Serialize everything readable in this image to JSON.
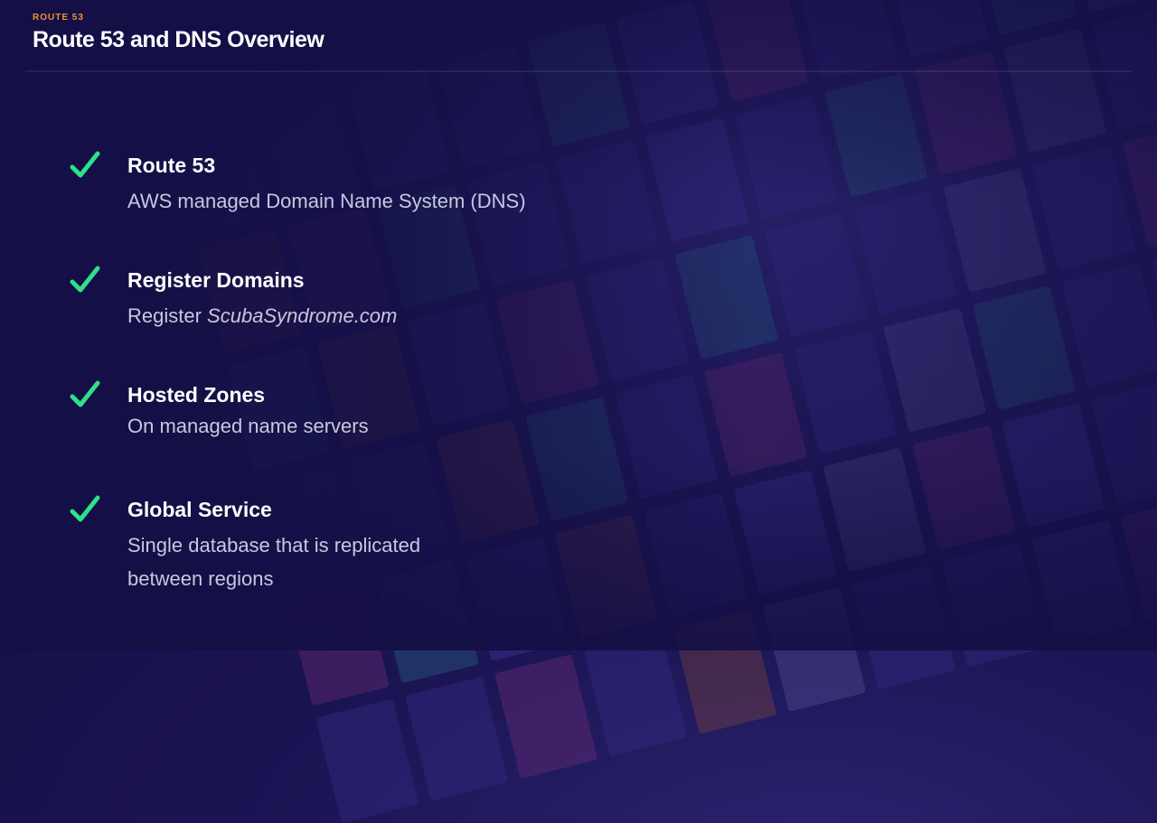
{
  "header": {
    "eyebrow": "ROUTE 53",
    "title": "Route 53 and DNS Overview"
  },
  "colors": {
    "accent_orange": "#f2922c",
    "check_green": "#2ee08a",
    "background": "#1c1555"
  },
  "items": [
    {
      "icon": "checkmark-icon",
      "title": "Route 53",
      "desc_plain": "AWS managed Domain Name System (DNS)"
    },
    {
      "icon": "checkmark-icon",
      "title": "Register Domains",
      "desc_prefix": "Register ",
      "desc_emphasis": "ScubaSyndrome.com"
    },
    {
      "icon": "checkmark-icon",
      "title": "Hosted Zones",
      "desc_plain": "On managed name servers"
    },
    {
      "icon": "checkmark-icon",
      "title": "Global Service",
      "desc_line1": "Single database that is replicated",
      "desc_line2": "between regions"
    }
  ]
}
